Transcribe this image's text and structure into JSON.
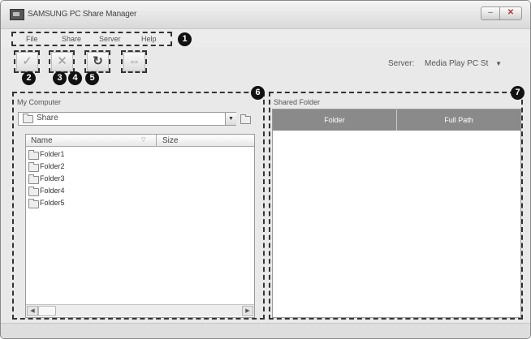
{
  "window": {
    "title": "SAMSUNG PC Share Manager",
    "minimize": "–",
    "close": "✕"
  },
  "menu": {
    "items": [
      "File",
      "Share",
      "Server",
      "Help"
    ]
  },
  "badges": [
    "1",
    "2",
    "3",
    "4",
    "5",
    "6",
    "7"
  ],
  "toolbar": {
    "buttons": [
      {
        "name": "share-folder",
        "icon": "check-icon",
        "glyph": "✓"
      },
      {
        "name": "cancel-share",
        "icon": "x-icon",
        "glyph": "✕"
      },
      {
        "name": "refresh",
        "icon": "refresh-icon",
        "glyph": "↻"
      },
      {
        "name": "set-device-policy",
        "icon": "device-icon",
        "glyph": "⇔"
      }
    ]
  },
  "server": {
    "label": "Server:",
    "selected": "Media Play PC St",
    "arrow": "▼"
  },
  "my_computer": {
    "title": "My Computer",
    "combo_value": "Share",
    "combo_arrow": "▼",
    "columns": {
      "name": "Name",
      "size": "Size",
      "sort_arrow": "▽"
    },
    "folders": [
      "Folder1",
      "Folder2",
      "Folder3",
      "Folder4",
      "Folder5"
    ],
    "scroll_left": "◀",
    "scroll_right": "▶"
  },
  "shared_folder": {
    "title": "Shared Folder",
    "columns": {
      "folder": "Folder",
      "full_path": "Full Path"
    }
  }
}
